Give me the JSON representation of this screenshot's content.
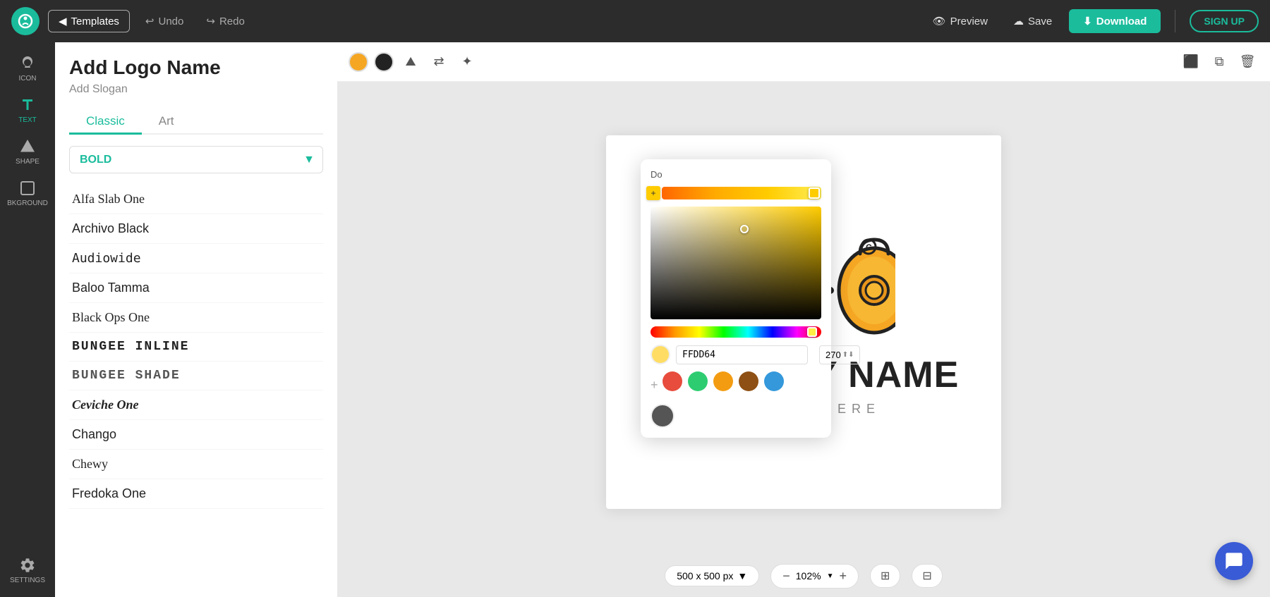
{
  "app": {
    "logo_symbol": "◎",
    "logo_bg": "#1abc9c"
  },
  "topnav": {
    "templates_label": "Templates",
    "undo_label": "Undo",
    "redo_label": "Redo",
    "preview_label": "Preview",
    "save_label": "Save",
    "download_label": "Download",
    "signup_label": "SIGN UP"
  },
  "sidebar": {
    "items": [
      {
        "id": "icon",
        "label": "ICON",
        "active": false
      },
      {
        "id": "text",
        "label": "TEXT",
        "active": true
      },
      {
        "id": "shape",
        "label": "SHAPE",
        "active": false
      },
      {
        "id": "bkground",
        "label": "BKGROUND",
        "active": false
      },
      {
        "id": "settings",
        "label": "SETTINGS",
        "active": false
      }
    ]
  },
  "font_panel": {
    "title": "Add Logo Name",
    "subtitle": "Add Slogan",
    "tabs": [
      {
        "label": "Classic",
        "active": true
      },
      {
        "label": "Art",
        "active": false
      }
    ],
    "style_label": "BOLD",
    "fonts": [
      {
        "name": "Alfa Slab One",
        "class": "font-alfa"
      },
      {
        "name": "Archivo Black",
        "class": "font-archivo"
      },
      {
        "name": "Audiowide",
        "class": "font-audiowide"
      },
      {
        "name": "Baloo Tamma",
        "class": "font-baloo"
      },
      {
        "name": "Black Ops One",
        "class": "font-black-ops"
      },
      {
        "name": "BUNGEE INLINE",
        "class": "font-bungee-inline"
      },
      {
        "name": "BUNGEE SHADE",
        "class": "font-bungee-shade"
      },
      {
        "name": "Ceviche One",
        "class": "font-ceviche"
      },
      {
        "name": "Chango",
        "class": "font-chango"
      },
      {
        "name": "Chewy",
        "class": "font-chewy"
      },
      {
        "name": "Fredoka One",
        "class": "font-fredoka"
      }
    ]
  },
  "canvas": {
    "company_name": "COMPANY NAME",
    "slogan": "SLOGAN HERE",
    "canvas_size": "500 x 500 px",
    "zoom_level": "102%"
  },
  "color_picker": {
    "title": "Do",
    "hex_value": "FFDD64",
    "opacity": "270",
    "presets": [
      {
        "color": "#e74c3c"
      },
      {
        "color": "#2ecc71"
      },
      {
        "color": "#f39c12"
      },
      {
        "color": "#8e5014"
      },
      {
        "color": "#3498db"
      }
    ],
    "bottom_color": "#555555"
  }
}
